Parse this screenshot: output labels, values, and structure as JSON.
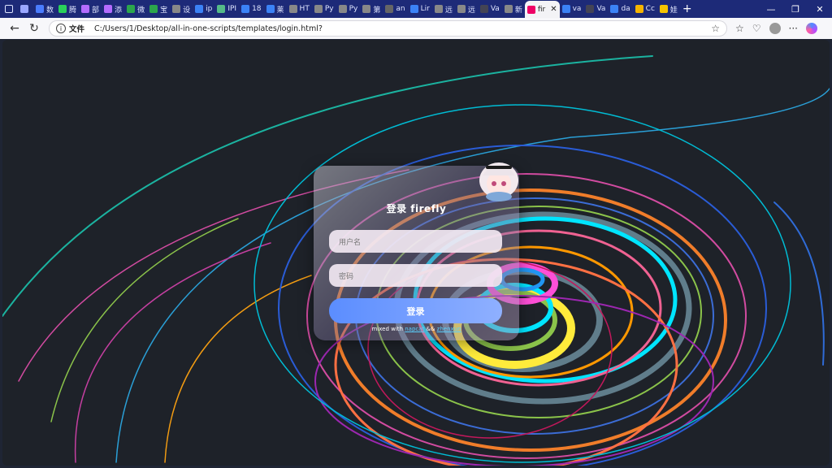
{
  "tabs": [
    {
      "label": "",
      "color": "#9aa7ff"
    },
    {
      "label": "数",
      "color": "#4a7cff"
    },
    {
      "label": "腾",
      "color": "#2ad05a"
    },
    {
      "label": "部",
      "color": "#b46cff"
    },
    {
      "label": "添",
      "color": "#b46cff"
    },
    {
      "label": "微",
      "color": "#2ca64c"
    },
    {
      "label": "宝",
      "color": "#2ca64c"
    },
    {
      "label": "设",
      "color": "#888"
    },
    {
      "label": "ip",
      "color": "#3b82f6"
    },
    {
      "label": "IPI",
      "color": "#5b8"
    },
    {
      "label": "18",
      "color": "#3b82f6"
    },
    {
      "label": "莱",
      "color": "#3b82f6"
    },
    {
      "label": "HT",
      "color": "#888"
    },
    {
      "label": "Py",
      "color": "#888"
    },
    {
      "label": "Py",
      "color": "#888"
    },
    {
      "label": "第",
      "color": "#888"
    },
    {
      "label": "an",
      "color": "#666"
    },
    {
      "label": "Lir",
      "color": "#3b82f6"
    },
    {
      "label": "远",
      "color": "#888"
    },
    {
      "label": "远",
      "color": "#888"
    },
    {
      "label": "Va",
      "color": "#445"
    },
    {
      "label": "新",
      "color": "#888"
    },
    {
      "label": "fir",
      "color": "#e06",
      "active": true
    },
    {
      "label": "va",
      "color": "#3b82f6"
    },
    {
      "label": "Va",
      "color": "#445"
    },
    {
      "label": "da",
      "color": "#3b82f6"
    },
    {
      "label": "Cc",
      "color": "#f5b400"
    },
    {
      "label": "娃",
      "color": "#f5c400"
    }
  ],
  "address": {
    "scheme_label": "文件",
    "url": "C:/Users/1/Desktop/all-in-one-scripts/templates/login.html?"
  },
  "login": {
    "title": "登录 firefly",
    "username_placeholder": "用户名",
    "password_placeholder": "密码",
    "submit_label": "登录",
    "credit_prefix": "mixed with",
    "credit_link1": "napcat",
    "credit_sep": "&&",
    "credit_link2": "zhenxun"
  },
  "colors": {
    "accent": "#5b8dff",
    "tabbar": "#1d2a78"
  }
}
